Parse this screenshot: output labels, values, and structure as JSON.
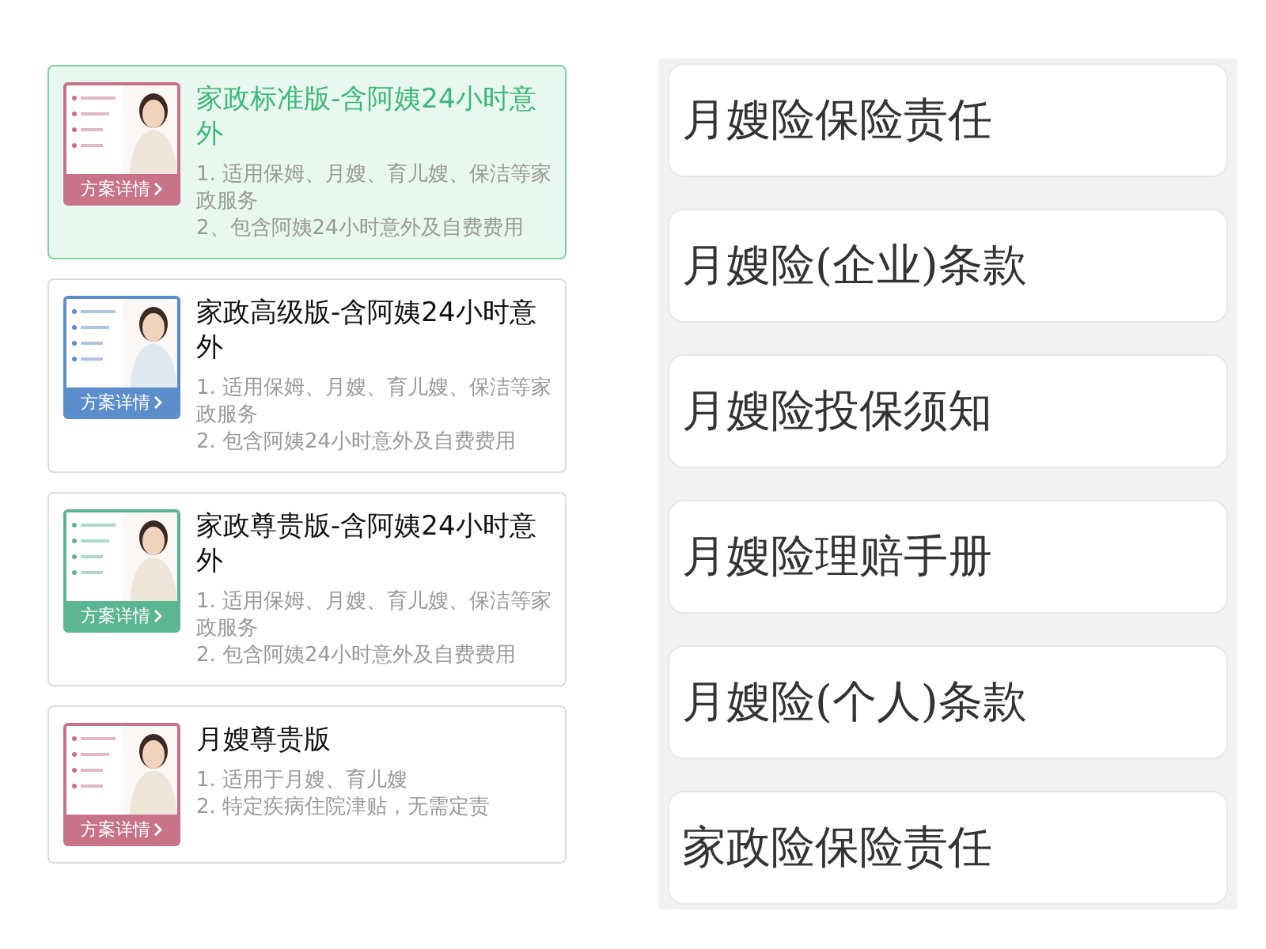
{
  "plans": [
    {
      "title": "家政标准版-含阿姨24小时意外",
      "details_label": "方案详情",
      "color": "#c8728a",
      "selected": true,
      "lines": [
        "1. 适用保姆、月嫂、育儿嫂、保洁等家政服务",
        "2、包含阿姨24小时意外及自费费用"
      ]
    },
    {
      "title": "家政高级版-含阿姨24小时意外",
      "details_label": "方案详情",
      "color": "#5b8ccc",
      "selected": false,
      "lines": [
        "1. 适用保姆、月嫂、育儿嫂、保洁等家政服务",
        "2. 包含阿姨24小时意外及自费费用"
      ]
    },
    {
      "title": "家政尊贵版-含阿姨24小时意外",
      "details_label": "方案详情",
      "color": "#5cb592",
      "selected": false,
      "lines": [
        "1. 适用保姆、月嫂、育儿嫂、保洁等家政服务",
        "2. 包含阿姨24小时意外及自费费用"
      ]
    },
    {
      "title": "月嫂尊贵版",
      "details_label": "方案详情",
      "color": "#c8728a",
      "selected": false,
      "lines": [
        "1. 适用于月嫂、育儿嫂",
        "2. 特定疾病住院津贴，无需定责"
      ]
    }
  ],
  "documents": [
    "月嫂险保险责任",
    "月嫂险(企业)条款",
    "月嫂险投保须知",
    "月嫂险理赔手册",
    "月嫂险(个人)条款",
    "家政险保险责任"
  ]
}
